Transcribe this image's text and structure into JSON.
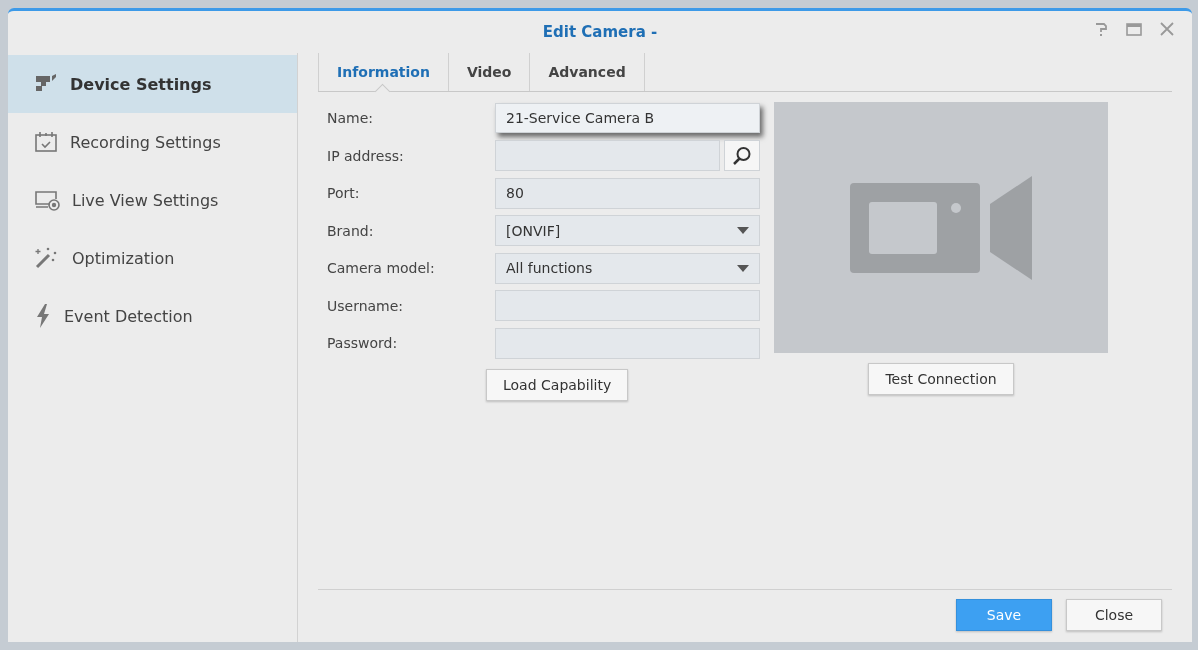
{
  "window": {
    "title": "Edit Camera -"
  },
  "sidebar": {
    "items": [
      {
        "label": "Device Settings",
        "selected": true
      },
      {
        "label": "Recording Settings",
        "selected": false
      },
      {
        "label": "Live View Settings",
        "selected": false
      },
      {
        "label": "Optimization",
        "selected": false
      },
      {
        "label": "Event Detection",
        "selected": false
      }
    ]
  },
  "tabs": [
    {
      "label": "Information",
      "selected": true
    },
    {
      "label": "Video",
      "selected": false
    },
    {
      "label": "Advanced",
      "selected": false
    }
  ],
  "form": {
    "fields": [
      {
        "label": "Name:",
        "kind": "text",
        "value": "21-Service Camera B",
        "focused": true
      },
      {
        "label": "IP address:",
        "kind": "search",
        "focused": false
      },
      {
        "label": "Port:",
        "kind": "text",
        "value": "80",
        "focused": false
      },
      {
        "label": "Brand:",
        "kind": "select",
        "value": "[ONVIF]",
        "focused": false
      },
      {
        "label": "Camera model:",
        "kind": "select",
        "value": "All functions",
        "focused": false
      },
      {
        "label": "Username:",
        "kind": "text",
        "focused": false
      },
      {
        "label": "Password:",
        "kind": "text",
        "focused": false
      }
    ],
    "load_button": "Load Capability"
  },
  "preview": {
    "test_button": "Test Connection"
  },
  "footer": {
    "buttons": [
      {
        "label": "Save",
        "primary": true
      },
      {
        "label": "Close",
        "primary": false
      }
    ]
  }
}
